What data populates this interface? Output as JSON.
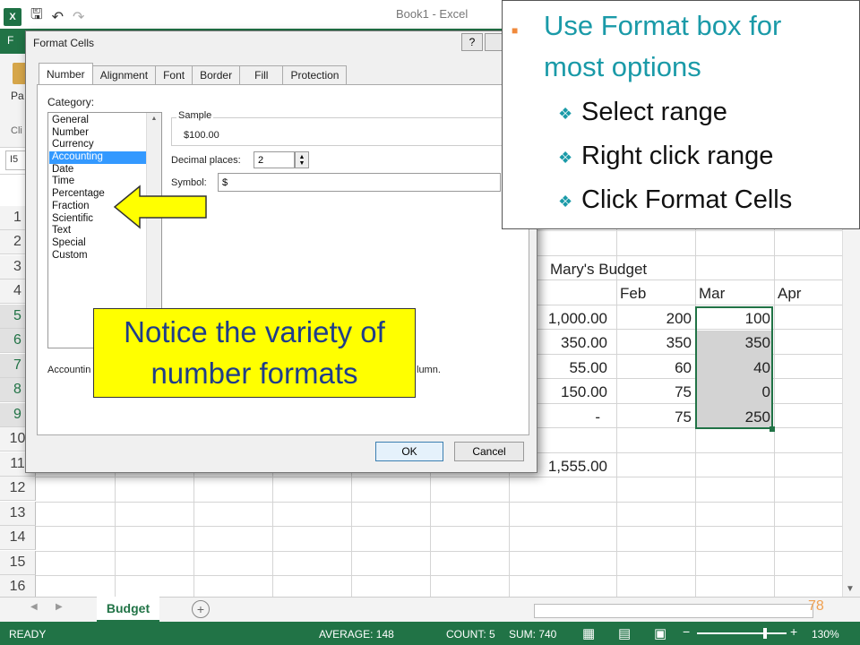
{
  "excel": {
    "window_title": "Book1 - Excel",
    "file_tab": "F",
    "paste_label": "Pa",
    "clipboard_label": "Cli",
    "name_box": "I5",
    "row_headers": [
      "1",
      "2",
      "3",
      "4",
      "5",
      "6",
      "7",
      "8",
      "9",
      "10",
      "11",
      "12",
      "13",
      "14",
      "15",
      "16"
    ],
    "budget_title": "Mary's Budget",
    "month_headers": [
      "Feb",
      "Mar",
      "Apr"
    ],
    "col_e": [
      "1,000.00",
      "350.00",
      "55.00",
      "150.00",
      "-"
    ],
    "col_e_total": "1,555.00",
    "feb": [
      "200",
      "350",
      "60",
      "75",
      "75"
    ],
    "mar": [
      "100",
      "350",
      "40",
      "0",
      "250"
    ],
    "sheet_tab": "Budget",
    "page_number": "78",
    "status": {
      "ready": "READY",
      "average": "AVERAGE: 148",
      "count": "COUNT: 5",
      "sum": "SUM: 740",
      "zoom": "130%"
    },
    "colors": {
      "excel_green": "#217346",
      "selection_fill": "#d3d3d3"
    }
  },
  "dialog": {
    "title": "Format Cells",
    "help": "?",
    "close": "X",
    "tabs": [
      "Number",
      "Alignment",
      "Font",
      "Border",
      "Fill",
      "Protection"
    ],
    "category_label": "Category:",
    "categories": [
      "General",
      "Number",
      "Currency",
      "Accounting",
      "Date",
      "Time",
      "Percentage",
      "Fraction",
      "Scientific",
      "Text",
      "Special",
      "Custom"
    ],
    "selected_category": "Accounting",
    "sample_label": "Sample",
    "sample_value": "$100.00",
    "decimal_label": "Decimal places:",
    "decimal_value": "2",
    "symbol_label": "Symbol:",
    "symbol_value": "$",
    "description_left": "Accountin",
    "description_right": "lumn.",
    "ok": "OK",
    "cancel": "Cancel"
  },
  "slide": {
    "main_bullet_line1": "Use Format box for",
    "main_bullet_line2": "most options",
    "sub_bullets": [
      "Select range",
      "Right click range",
      "Click Format Cells"
    ],
    "callout_line1": "Notice the variety of",
    "callout_line2": "number formats",
    "colors": {
      "bullet_teal": "#1a9aa8",
      "callout_yellow": "#ffff00",
      "callout_text": "#1f3d8a"
    }
  }
}
